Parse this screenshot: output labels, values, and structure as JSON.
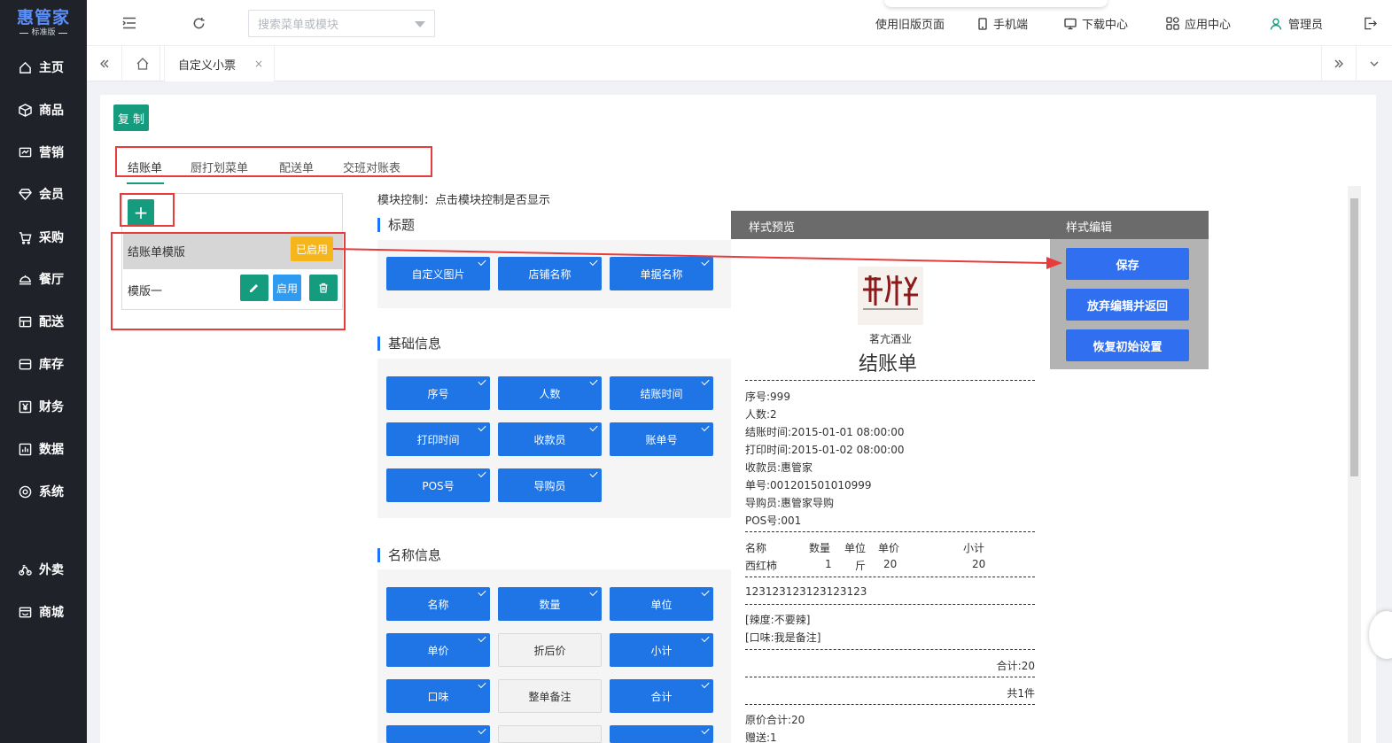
{
  "brand": {
    "name": "惠管家",
    "edition": "标准版"
  },
  "sidebar": {
    "items": [
      {
        "label": "主页",
        "icon": "home-icon"
      },
      {
        "label": "商品",
        "icon": "box-icon"
      },
      {
        "label": "营销",
        "icon": "chart-icon"
      },
      {
        "label": "会员",
        "icon": "diamond-icon"
      },
      {
        "label": "采购",
        "icon": "cart-icon"
      },
      {
        "label": "餐厅",
        "icon": "dish-icon"
      },
      {
        "label": "配送",
        "icon": "truck-icon"
      },
      {
        "label": "库存",
        "icon": "warehouse-icon"
      },
      {
        "label": "财务",
        "icon": "yen-icon"
      },
      {
        "label": "数据",
        "icon": "bar-chart-icon"
      },
      {
        "label": "系统",
        "icon": "settings-icon"
      },
      {
        "label": "外卖",
        "icon": "bike-icon"
      },
      {
        "label": "商城",
        "icon": "shop-icon"
      }
    ]
  },
  "header": {
    "search_placeholder": "搜索菜单或模块",
    "links": {
      "old_version": "使用旧版页面",
      "mobile": "手机端",
      "download": "下载中心",
      "apps": "应用中心",
      "user": "管理员"
    }
  },
  "tabstrip": {
    "active_tab": "自定义小票",
    "close": "×"
  },
  "toolbar": {
    "copy_label": "复 制"
  },
  "doc_tabs": [
    "结账单",
    "厨打划菜单",
    "配送单",
    "交班对账表"
  ],
  "templates": {
    "add_label": "+",
    "items": [
      {
        "name": "结账单模版",
        "status": "已启用"
      },
      {
        "name": "模版一",
        "enable_label": "启用"
      }
    ]
  },
  "module_control": {
    "hint": "模块控制：点击模块控制是否显示",
    "sections": [
      {
        "title": "标题",
        "fields": [
          {
            "label": "自定义图片",
            "on": true
          },
          {
            "label": "店铺名称",
            "on": true
          },
          {
            "label": "单据名称",
            "on": true
          }
        ]
      },
      {
        "title": "基础信息",
        "fields": [
          {
            "label": "序号",
            "on": true
          },
          {
            "label": "人数",
            "on": true
          },
          {
            "label": "结账时间",
            "on": true
          },
          {
            "label": "打印时间",
            "on": true
          },
          {
            "label": "收款员",
            "on": true
          },
          {
            "label": "账单号",
            "on": true
          },
          {
            "label": "POS号",
            "on": true
          },
          {
            "label": "导购员",
            "on": true
          }
        ]
      },
      {
        "title": "名称信息",
        "fields": [
          {
            "label": "名称",
            "on": true
          },
          {
            "label": "数量",
            "on": true
          },
          {
            "label": "单位",
            "on": true
          },
          {
            "label": "单价",
            "on": true
          },
          {
            "label": "折后价",
            "on": false
          },
          {
            "label": "小计",
            "on": true
          },
          {
            "label": "口味",
            "on": true
          },
          {
            "label": "整单备注",
            "on": false
          },
          {
            "label": "合计",
            "on": true
          }
        ]
      }
    ]
  },
  "preview": {
    "header_preview": "样式预览",
    "header_edit": "样式编辑",
    "store_name": "茗亢酒业",
    "doc_title": "结账单",
    "info_lines": [
      "序号:999",
      "人数:2",
      "结账时间:2015-01-01 08:00:00",
      "打印时间:2015-01-02 08:00:00",
      "收款员:惠管家",
      "单号:001201501010999",
      "导购员:惠管家导购",
      "POS号:001"
    ],
    "table": {
      "headers": [
        "名称",
        "数量",
        "单位",
        "单价",
        "小计"
      ],
      "row": [
        "西红柿",
        "1",
        "斤",
        "20",
        "20"
      ]
    },
    "code_line": "123123123123123123",
    "notes": [
      "[辣度:不要辣]",
      "[口味:我是备注]"
    ],
    "total": "合计:20",
    "count": "共1件",
    "original_total": "原价合计:20",
    "gift": "赠送:1"
  },
  "edit_buttons": {
    "save": "保存",
    "discard": "放弃编辑并返回",
    "reset": "恢复初始设置"
  },
  "colors": {
    "primary": "#1f74e6",
    "green": "#159b7d",
    "annotation_red": "#e83b3b",
    "enabled_tag": "#f6b61b",
    "sidebar_bg": "#20222a"
  }
}
